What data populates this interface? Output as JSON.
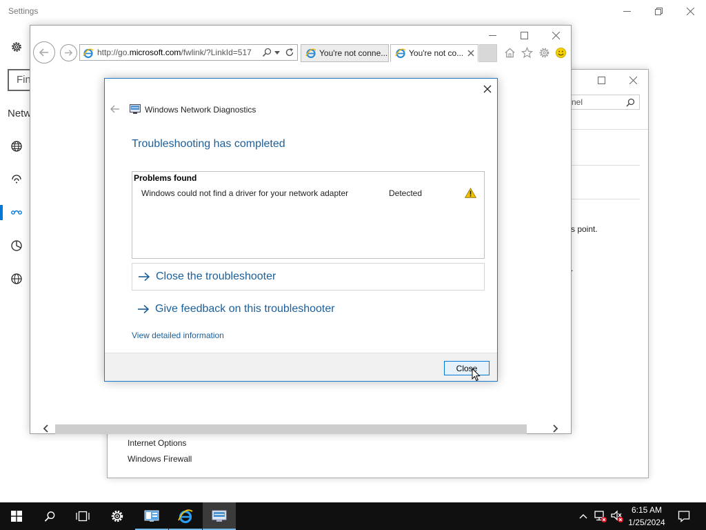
{
  "settings": {
    "title": "Settings",
    "search_placeholder": "Find",
    "section_heading": "Netw",
    "nav_icons": [
      "globe-network-icon",
      "wifi-icon",
      "vpn-icon",
      "data-usage-icon",
      "globe-icon"
    ]
  },
  "control_panel": {
    "search_text": "nel",
    "text_point": "s point.",
    "text_dot": ".",
    "see_also": [
      "Internet Options",
      "Windows Firewall"
    ]
  },
  "ie": {
    "url_prefix": "http://go.",
    "url_domain": "microsoft.com",
    "url_suffix": "/fwlink/?LinkId=517",
    "tabs": [
      {
        "label": "You're not conne..."
      },
      {
        "label": "You're not co..."
      }
    ]
  },
  "dialog": {
    "app_title": "Windows Network Diagnostics",
    "heading": "Troubleshooting has completed",
    "problems_title": "Problems found",
    "problem": {
      "text": "Windows could not find a driver for your network adapter",
      "status": "Detected"
    },
    "links": {
      "close_troubleshooter": "Close the troubleshooter",
      "give_feedback": "Give feedback on this troubleshooter",
      "view_details": "View detailed information"
    },
    "close_button": "Close"
  },
  "taskbar": {
    "time": "6:15 AM",
    "date": "1/25/2024"
  },
  "colors": {
    "accent": "#0078d7",
    "link_blue": "#1a5f9a",
    "taskbar": "#101010",
    "warning": "#f2c200"
  }
}
